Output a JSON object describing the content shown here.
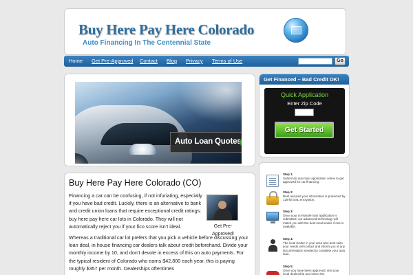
{
  "header": {
    "title": "Buy Here Pay Here Colorado",
    "tagline": "Auto Financing In The Centennial State"
  },
  "nav": {
    "items": [
      "Home",
      "Get Pre-Approved",
      "Contact",
      "Blog",
      "Privacy",
      "Terms of Use"
    ],
    "search_value": "",
    "search_button": "Go"
  },
  "slider": {
    "banner": "Auto Loan Quotes"
  },
  "article": {
    "title": "Buy Here Pay Here Colorado (CO)",
    "p1": "Financing a car can be confusing, if not infuriating, especially if you have bad credit. Luckily, there is an alternative to bank and credit union loans that require exceptional credit ratings: buy here pay here car lots in Colorado. They will not automatically reject you if your fico score isn’t ideal.",
    "p2": "Whereas a traditional car lot prefers that you pick a vehicle before discussing your loan deal, in house financing car dealers talk about credit beforehand. Divide your monthly income by 10, and don’t devote in excess of this on auto payments. For the typical resident of Colorado who earns $42,800 each year, this is paying roughly $357 per month. Dealerships oftentimes",
    "preapproved_caption": "Get Pre-Approved!"
  },
  "quick_app": {
    "header": "Get Financed – Bad Credit OK!",
    "title": "Quick Application",
    "zip_label": "Enter Zip Code",
    "zip_value": "",
    "button": "Get Started"
  },
  "steps": [
    {
      "label": "Step 1:",
      "text": "Submit an auto loan application online to get approved for car financing.",
      "icon": "form-icon"
    },
    {
      "label": "Step 2:",
      "text": "Rest assured your information is protected by 128-bit SSL encryption.",
      "icon": "lock-icon"
    },
    {
      "label": "Step 3:",
      "text": "Once your no-hassle loan application is submitted, our advanced technology will match you with the best local lender if one is available.",
      "icon": "monitor-icon"
    },
    {
      "label": "Step 4:",
      "text": "The local lender in your area who best suits your needs will contact and inform you of any documentation needed to complete your auto loan.",
      "icon": "person-icon"
    },
    {
      "label": "Step 5:",
      "text": "Once you have been approved, visit your local dealership and select the",
      "icon": "car-icon"
    }
  ],
  "colors": {
    "nav_blue": "#2a6fad",
    "title_blue": "#2f6f9e",
    "button_green": "#5cb82e",
    "quick_app_bg": "#141414"
  }
}
